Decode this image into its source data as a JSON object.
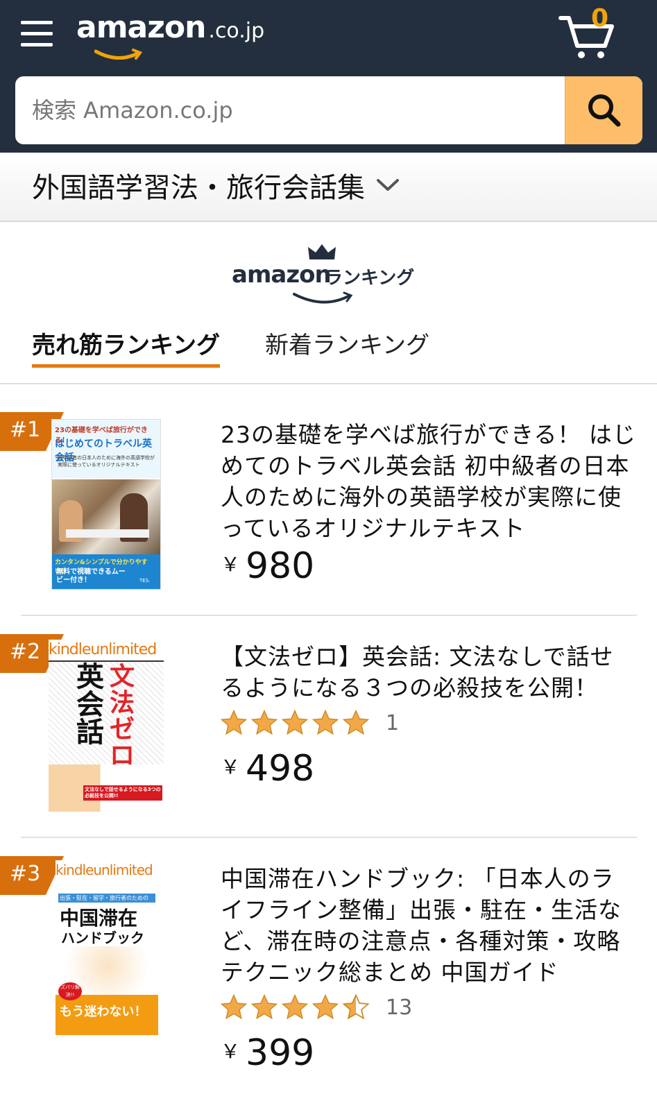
{
  "header": {
    "logo_text": "amazon",
    "logo_suffix": ".co.jp",
    "cart_count": "0"
  },
  "search": {
    "placeholder": "検索 Amazon.co.jp"
  },
  "category": {
    "label": "外国語学習法・旅行会話集"
  },
  "ranking_logo": {
    "brand": "amazon",
    "label": "ランキング"
  },
  "tabs": [
    {
      "label": "売れ筋ランキング",
      "active": true
    },
    {
      "label": "新着ランキング",
      "active": false
    }
  ],
  "colors": {
    "header_bg": "#232f3e",
    "accent_orange": "#e47911",
    "search_button": "#febd69",
    "star": "#f3a847"
  },
  "items": [
    {
      "rank": "#1",
      "title": "23の基礎を学べば旅行ができる！ はじめてのトラベル英会話 初中級者の日本人のために海外の英語学校が実際に使っているオリジナルテキスト",
      "price_symbol": "￥",
      "price": "980",
      "rating": null,
      "rating_count": null,
      "cover_texts": [
        "23の基礎を学べば旅行ができる！",
        "はじめてのトラベル英会話",
        "初中級者の日本人のために海外の英語学校が実際に使っているオリジナルテキスト",
        "カンタン&シンプルで分かりやすい！",
        "無料で視聴できるムービー付き！",
        "TES."
      ]
    },
    {
      "rank": "#2",
      "title": "【文法ゼロ】英会話: 文法なしで話せるようになる３つの必殺技を公開！",
      "price_symbol": "￥",
      "price": "498",
      "rating": 5,
      "rating_count": "1",
      "cover_texts": [
        "kindleunlimited",
        "英会話",
        "文法ゼロ",
        "文法なしで話せるようになる3つの必殺技を公開!!"
      ]
    },
    {
      "rank": "#3",
      "title": "中国滞在ハンドブック: 「日本人のライフライン整備」出張・駐在・生活など、滞在時の注意点・各種対策・攻略テクニック総まとめ 中国ガイド",
      "price_symbol": "￥",
      "price": "399",
      "rating": 4.5,
      "rating_count": "13",
      "cover_texts": [
        "kindleunlimited",
        "出張・駐在・留学・旅行者のための",
        "中国滞在",
        "ハンドブック",
        "ズバリ解決!!",
        "もう迷わない！"
      ]
    }
  ]
}
